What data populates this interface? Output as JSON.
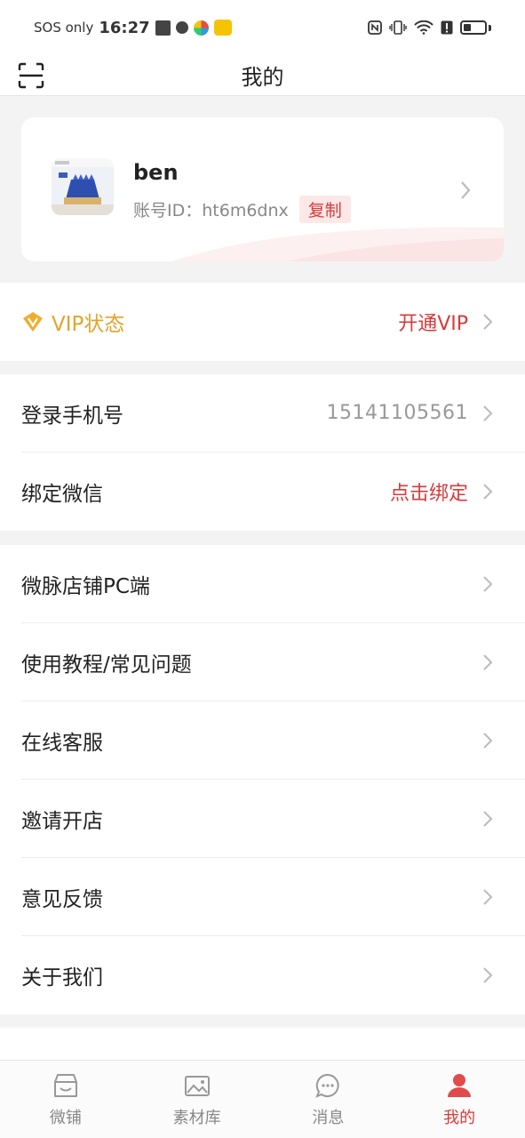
{
  "status_bar": {
    "carrier": "SOS only",
    "time": "16:27"
  },
  "header": {
    "title": "我的"
  },
  "profile": {
    "name": "ben",
    "account_label": "账号ID：ht6m6dnx",
    "copy_label": "复制"
  },
  "vip": {
    "label": "VIP状态",
    "action": "开通VIP"
  },
  "account_section": {
    "phone_label": "登录手机号",
    "phone_value": "15141105561",
    "wechat_label": "绑定微信",
    "wechat_value": "点击绑定"
  },
  "menu": {
    "items": [
      {
        "label": "微脉店铺PC端"
      },
      {
        "label": "使用教程/常见问题"
      },
      {
        "label": "在线客服"
      },
      {
        "label": "邀请开店"
      },
      {
        "label": "意见反馈"
      },
      {
        "label": "关于我们"
      }
    ]
  },
  "bottom_nav": {
    "items": [
      {
        "label": "微铺",
        "icon": "store-icon"
      },
      {
        "label": "素材库",
        "icon": "image-icon"
      },
      {
        "label": "消息",
        "icon": "chat-icon"
      },
      {
        "label": "我的",
        "icon": "user-icon"
      }
    ],
    "active_index": 3
  },
  "colors": {
    "accent_red": "#d93a3a",
    "vip_gold": "#e3a42e"
  }
}
